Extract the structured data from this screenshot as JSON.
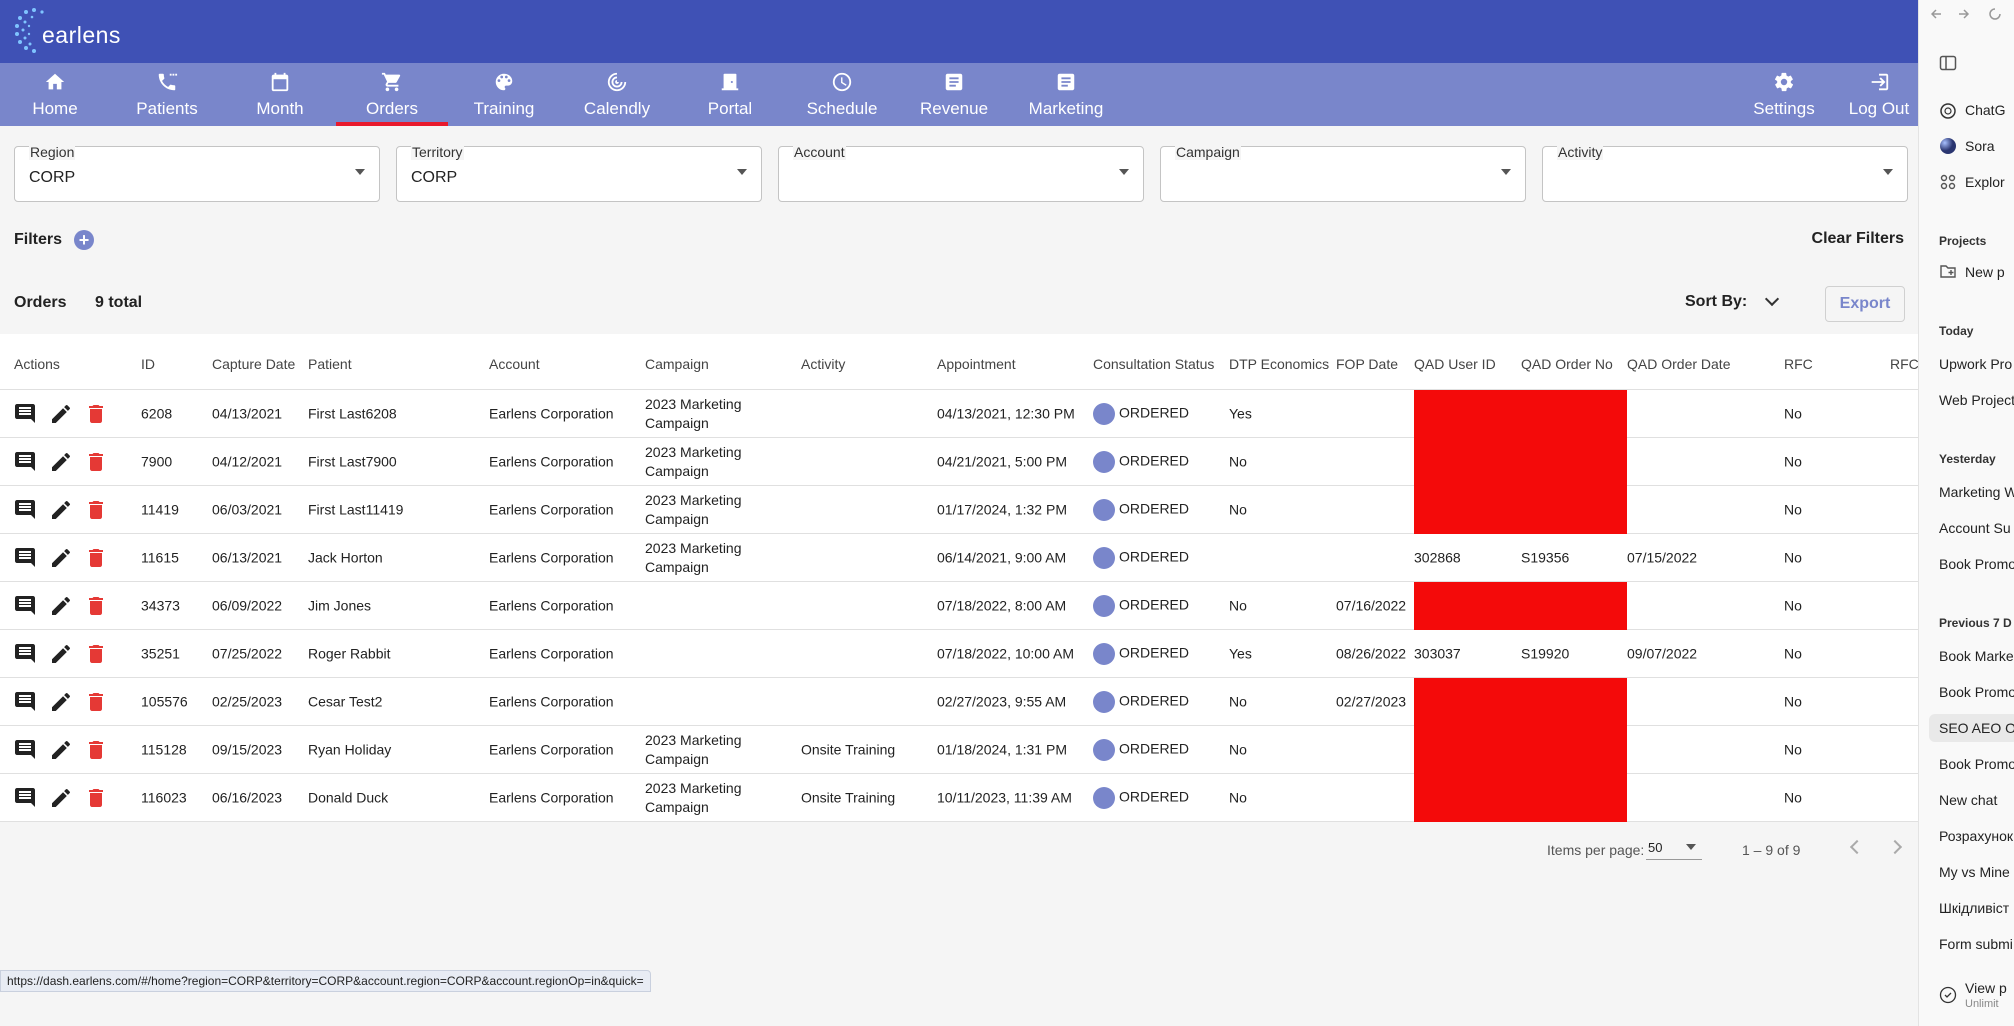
{
  "brand": {
    "name": "earlens"
  },
  "nav": {
    "items": [
      {
        "label": "Home",
        "icon": "home-icon"
      },
      {
        "label": "Patients",
        "icon": "phone-icon"
      },
      {
        "label": "Month",
        "icon": "calendar-icon"
      },
      {
        "label": "Orders",
        "icon": "cart-icon",
        "active": true
      },
      {
        "label": "Training",
        "icon": "palette-icon"
      },
      {
        "label": "Calendly",
        "icon": "target-icon"
      },
      {
        "label": "Portal",
        "icon": "door-icon"
      },
      {
        "label": "Schedule",
        "icon": "clock-icon"
      },
      {
        "label": "Revenue",
        "icon": "document-icon"
      },
      {
        "label": "Marketing",
        "icon": "document-icon"
      },
      {
        "label": "Settings",
        "icon": "gear-icon"
      },
      {
        "label": "Log Out",
        "icon": "logout-icon"
      }
    ]
  },
  "filters": {
    "region": {
      "label": "Region",
      "value": "CORP"
    },
    "territory": {
      "label": "Territory",
      "value": "CORP"
    },
    "account": {
      "label": "Account",
      "value": ""
    },
    "campaign": {
      "label": "Campaign",
      "value": ""
    },
    "activity": {
      "label": "Activity",
      "value": ""
    },
    "filters_label": "Filters",
    "clear_label": "Clear Filters"
  },
  "summary": {
    "orders_label": "Orders",
    "total_label": "9 total",
    "sort_label": "Sort By:",
    "export_label": "Export"
  },
  "table": {
    "columns": [
      "Actions",
      "ID",
      "Capture Date",
      "Patient",
      "Account",
      "Campaign",
      "Activity",
      "Appointment",
      "Consultation Status",
      "DTP Economics",
      "FOP Date",
      "QAD User ID",
      "QAD Order No",
      "QAD Order Date",
      "RFC",
      "RFC"
    ],
    "rows": [
      {
        "id": "6208",
        "capture": "04/13/2021",
        "patient": "First Last6208",
        "account": "Earlens Corporation",
        "campaign": "2023 Marketing Campaign",
        "activity": "",
        "appointment": "04/13/2021, 12:30 PM",
        "status": "ORDERED",
        "dtp": "Yes",
        "fop": "",
        "qad_user": "",
        "qad_order": "",
        "qad_date": "",
        "rfc": "No",
        "redacted": true
      },
      {
        "id": "7900",
        "capture": "04/12/2021",
        "patient": "First Last7900",
        "account": "Earlens Corporation",
        "campaign": "2023 Marketing Campaign",
        "activity": "",
        "appointment": "04/21/2021, 5:00 PM",
        "status": "ORDERED",
        "dtp": "No",
        "fop": "",
        "qad_user": "",
        "qad_order": "",
        "qad_date": "",
        "rfc": "No",
        "redacted": true
      },
      {
        "id": "11419",
        "capture": "06/03/2021",
        "patient": "First Last11419",
        "account": "Earlens Corporation",
        "campaign": "2023 Marketing Campaign",
        "activity": "",
        "appointment": "01/17/2024, 1:32 PM",
        "status": "ORDERED",
        "dtp": "No",
        "fop": "",
        "qad_user": "",
        "qad_order": "",
        "qad_date": "",
        "rfc": "No",
        "redacted": true
      },
      {
        "id": "11615",
        "capture": "06/13/2021",
        "patient": "Jack Horton",
        "account": "Earlens Corporation",
        "campaign": "2023 Marketing Campaign",
        "activity": "",
        "appointment": "06/14/2021, 9:00 AM",
        "status": "ORDERED",
        "dtp": "",
        "fop": "",
        "qad_user": "302868",
        "qad_order": "S19356",
        "qad_date": "07/15/2022",
        "rfc": "No",
        "redacted": false
      },
      {
        "id": "34373",
        "capture": "06/09/2022",
        "patient": "Jim Jones",
        "account": "Earlens Corporation",
        "campaign": "",
        "activity": "",
        "appointment": "07/18/2022, 8:00 AM",
        "status": "ORDERED",
        "dtp": "No",
        "fop": "07/16/2022",
        "qad_user": "",
        "qad_order": "",
        "qad_date": "",
        "rfc": "No",
        "redacted": true
      },
      {
        "id": "35251",
        "capture": "07/25/2022",
        "patient": "Roger Rabbit",
        "account": "Earlens Corporation",
        "campaign": "",
        "activity": "",
        "appointment": "07/18/2022, 10:00 AM",
        "status": "ORDERED",
        "dtp": "Yes",
        "fop": "08/26/2022",
        "qad_user": "303037",
        "qad_order": "S19920",
        "qad_date": "09/07/2022",
        "rfc": "No",
        "redacted": false
      },
      {
        "id": "105576",
        "capture": "02/25/2023",
        "patient": "Cesar Test2",
        "account": "Earlens Corporation",
        "campaign": "",
        "activity": "",
        "appointment": "02/27/2023, 9:55 AM",
        "status": "ORDERED",
        "dtp": "No",
        "fop": "02/27/2023",
        "qad_user": "",
        "qad_order": "",
        "qad_date": "",
        "rfc": "No",
        "redacted": true
      },
      {
        "id": "115128",
        "capture": "09/15/2023",
        "patient": "Ryan Holiday",
        "account": "Earlens Corporation",
        "campaign": "2023 Marketing Campaign",
        "activity": "Onsite Training",
        "appointment": "01/18/2024, 1:31 PM",
        "status": "ORDERED",
        "dtp": "No",
        "fop": "",
        "qad_user": "",
        "qad_order": "",
        "qad_date": "",
        "rfc": "No",
        "redacted": true
      },
      {
        "id": "116023",
        "capture": "06/16/2023",
        "patient": "Donald Duck",
        "account": "Earlens Corporation",
        "campaign": "2023 Marketing Campaign",
        "activity": "Onsite Training",
        "appointment": "10/11/2023, 11:39 AM",
        "status": "ORDERED",
        "dtp": "No",
        "fop": "",
        "qad_user": "",
        "qad_order": "",
        "qad_date": "",
        "rfc": "No",
        "redacted": true
      }
    ]
  },
  "pagination": {
    "items_per_page_label": "Items per page:",
    "items_per_page": "50",
    "range": "1 – 9 of 9"
  },
  "status_url": "https://dash.earlens.com/#/home?region=CORP&territory=CORP&account.region=CORP&account.regionOp=in&quick=",
  "sidebar": {
    "top_items": [
      {
        "label": "ChatG",
        "icon": "chatgpt-icon"
      },
      {
        "label": "Sora",
        "icon": "sora-icon"
      },
      {
        "label": "Explor",
        "icon": "grid-icon"
      }
    ],
    "projects_head": "Projects",
    "new_project": "New p",
    "today_head": "Today",
    "today": [
      "Upwork Pro",
      "Web Project"
    ],
    "yesterday_head": "Yesterday",
    "yesterday": [
      "Marketing W",
      "Account Su",
      "Book Promo"
    ],
    "prev_head": "Previous 7 D",
    "prev": [
      "Book Marke",
      "Book Promo",
      "SEO AEO O",
      "Book Promo",
      "New chat",
      "Розрахунок",
      "My vs Mine",
      "Шкідливіст",
      "Form submi"
    ],
    "view_plans": "View p",
    "view_plans_sub": "Unlimit"
  },
  "colors": {
    "header": "#3f51b5",
    "navbar": "#7986cb",
    "active_underline": "#e8192c",
    "redaction": "#f40a0a",
    "delete_icon": "#e53935"
  }
}
